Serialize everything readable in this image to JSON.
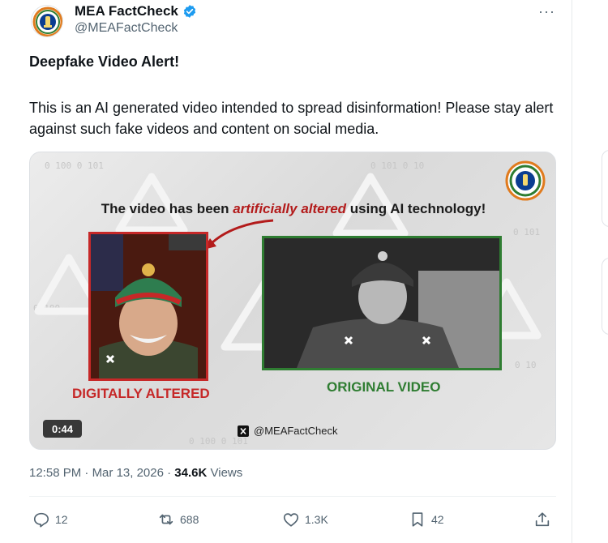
{
  "author": {
    "name": "MEA FactCheck",
    "handle": "@MEAFactCheck",
    "verified": true,
    "avatar_icon": "mea-emblem-icon"
  },
  "post": {
    "headline": "Deepfake Video Alert!",
    "body": "This is an AI generated video intended to spread disinformation! Please stay alert against such fake videos and content on social media."
  },
  "media": {
    "headline_pre": "The video has been ",
    "headline_em": "artificially altered",
    "headline_post": " using AI technology!",
    "label_altered": "DIGITALLY ALTERED",
    "label_original": "ORIGINAL VIDEO",
    "watermark": "@MEAFactCheck",
    "duration": "0:44",
    "badge_icon": "fact-check-badge-icon",
    "colors": {
      "altered": "#c62828",
      "original": "#2f7d32"
    }
  },
  "meta": {
    "time": "12:58 PM",
    "separator": "·",
    "date": "Mar 13, 2026",
    "views_count": "34.6K",
    "views_label": "Views"
  },
  "actions": {
    "replies": "12",
    "reposts": "688",
    "likes": "1.3K",
    "bookmarks": "42"
  }
}
